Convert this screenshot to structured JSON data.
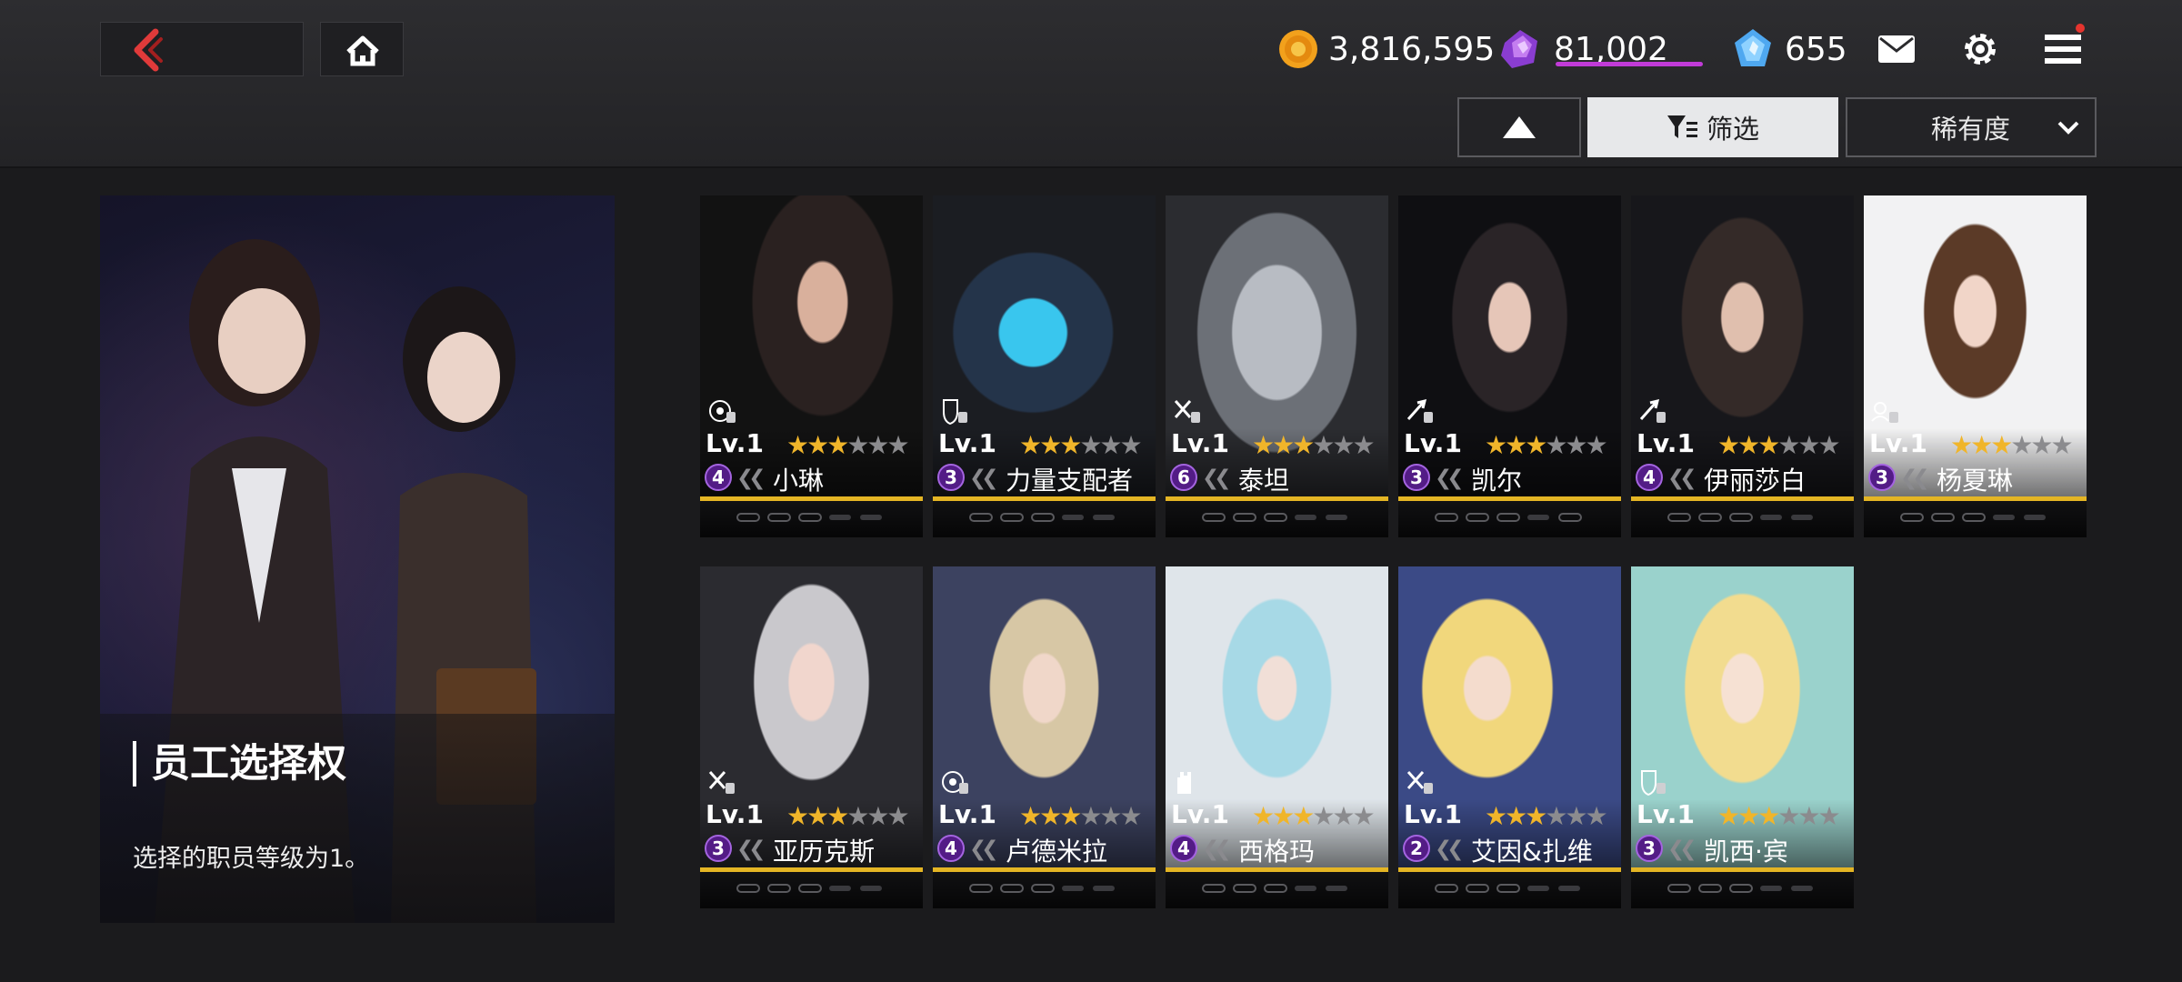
{
  "header": {
    "currencies": [
      {
        "icon": "gold-coin-icon",
        "value": "3,816,595"
      },
      {
        "icon": "purple-crystal-icon",
        "value": "81,002"
      },
      {
        "icon": "blue-diamond-icon",
        "value": "655"
      }
    ],
    "icons": [
      "mail-icon",
      "settings-icon",
      "menu-icon"
    ]
  },
  "toolbar": {
    "filter_label": "筛选",
    "sort_label": "稀有度"
  },
  "info_panel": {
    "title": "员工选择权",
    "description": "选择的职员等级为1。"
  },
  "cards": [
    {
      "level": "Lv.1",
      "grade": "4",
      "name": "小琳",
      "stars": 3,
      "class_icon": "target-class-icon"
    },
    {
      "level": "Lv.1",
      "grade": "3",
      "name": "力量支配者",
      "stars": 3,
      "class_icon": "shield-class-icon"
    },
    {
      "level": "Lv.1",
      "grade": "6",
      "name": "泰坦",
      "stars": 3,
      "class_icon": "swords-class-icon"
    },
    {
      "level": "Lv.1",
      "grade": "3",
      "name": "凯尔",
      "stars": 3,
      "class_icon": "blade-class-icon"
    },
    {
      "level": "Lv.1",
      "grade": "4",
      "name": "伊丽莎白",
      "stars": 3,
      "class_icon": "blade-class-icon"
    },
    {
      "level": "Lv.1",
      "grade": "3",
      "name": "杨夏琳",
      "stars": 3,
      "class_icon": "support-class-icon"
    },
    {
      "level": "Lv.1",
      "grade": "3",
      "name": "亚历克斯",
      "stars": 3,
      "class_icon": "swords-class-icon"
    },
    {
      "level": "Lv.1",
      "grade": "4",
      "name": "卢德米拉",
      "stars": 3,
      "class_icon": "target-class-icon"
    },
    {
      "level": "Lv.1",
      "grade": "4",
      "name": "西格玛",
      "stars": 3,
      "class_icon": "tower-class-icon"
    },
    {
      "level": "Lv.1",
      "grade": "2",
      "name": "艾因&扎维",
      "stars": 3,
      "class_icon": "swords-class-icon"
    },
    {
      "level": "Lv.1",
      "grade": "3",
      "name": "凯西·宾",
      "stars": 3,
      "class_icon": "shield-class-icon"
    }
  ],
  "colors": {
    "accent_red": "#e03a3a",
    "star_gold": "#f0b52a",
    "grade_purple": "#531c86",
    "card_gold_line": "#e4b524"
  }
}
